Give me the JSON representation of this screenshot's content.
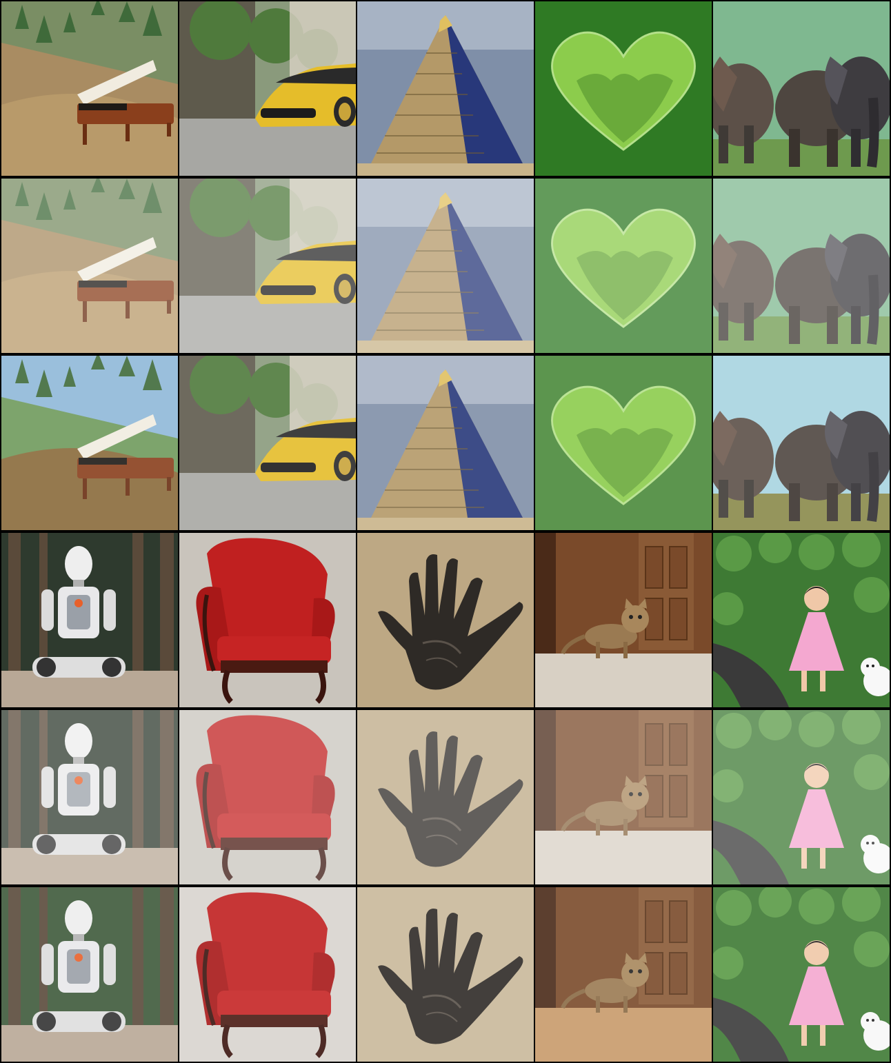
{
  "grid": {
    "columns": 5,
    "rows": 6,
    "cells": [
      {
        "subject": "grand-piano",
        "scene": "forest-hillside",
        "variant": 1
      },
      {
        "subject": "yellow-car",
        "scene": "street",
        "variant": 1
      },
      {
        "subject": "pyramid",
        "scene": "desert",
        "variant": 1
      },
      {
        "subject": "heart",
        "scene": "green-field",
        "variant": 1
      },
      {
        "subject": "elephants",
        "scene": "savanna",
        "variant": 1
      },
      {
        "subject": "grand-piano",
        "scene": "forest-hillside",
        "variant": 2
      },
      {
        "subject": "yellow-car",
        "scene": "street",
        "variant": 2
      },
      {
        "subject": "pyramid",
        "scene": "desert",
        "variant": 2
      },
      {
        "subject": "heart",
        "scene": "green-field",
        "variant": 2
      },
      {
        "subject": "elephants",
        "scene": "savanna",
        "variant": 2
      },
      {
        "subject": "grand-piano",
        "scene": "forest-hillside",
        "variant": 3
      },
      {
        "subject": "yellow-car",
        "scene": "street",
        "variant": 3
      },
      {
        "subject": "pyramid",
        "scene": "desert",
        "variant": 3
      },
      {
        "subject": "heart",
        "scene": "green-field",
        "variant": 3
      },
      {
        "subject": "elephants",
        "scene": "savanna",
        "variant": 3
      },
      {
        "subject": "robot",
        "scene": "forest",
        "variant": 1
      },
      {
        "subject": "red-armchair",
        "scene": "studio",
        "variant": 1
      },
      {
        "subject": "hand",
        "scene": "beige",
        "variant": 1
      },
      {
        "subject": "tabby-cat",
        "scene": "doorway",
        "variant": 1
      },
      {
        "subject": "toddler-and-dog",
        "scene": "garden-path",
        "variant": 1
      },
      {
        "subject": "robot",
        "scene": "forest",
        "variant": 2
      },
      {
        "subject": "red-armchair",
        "scene": "studio",
        "variant": 2
      },
      {
        "subject": "hand",
        "scene": "beige",
        "variant": 2
      },
      {
        "subject": "tabby-cat",
        "scene": "doorway",
        "variant": 2
      },
      {
        "subject": "toddler-and-dog",
        "scene": "garden-path",
        "variant": 2
      },
      {
        "subject": "robot",
        "scene": "forest",
        "variant": 3
      },
      {
        "subject": "red-armchair",
        "scene": "studio",
        "variant": 3
      },
      {
        "subject": "hand",
        "scene": "beige",
        "variant": 3
      },
      {
        "subject": "tabby-cat",
        "scene": "doorway",
        "variant": 3
      },
      {
        "subject": "toddler-and-dog",
        "scene": "garden-path",
        "variant": 3
      }
    ]
  }
}
